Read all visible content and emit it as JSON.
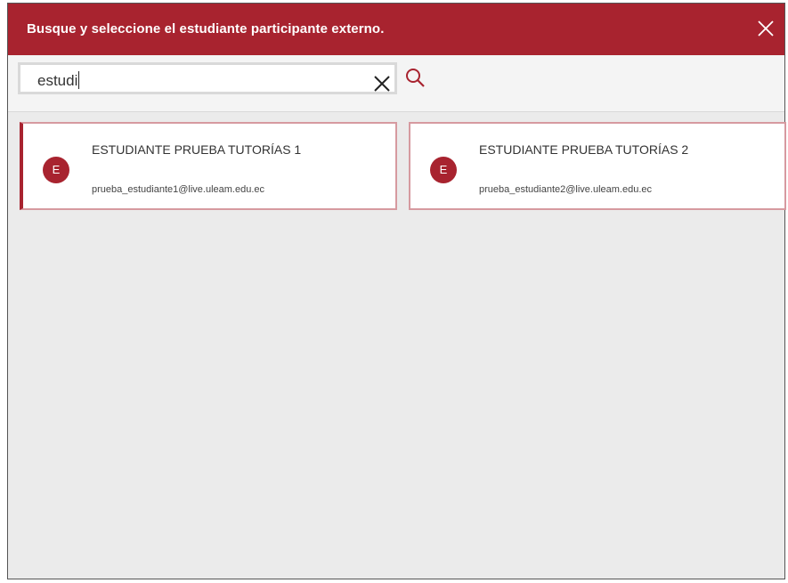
{
  "dialog": {
    "title": "Busque y seleccione el estudiante participante externo.",
    "close_icon": "close-icon"
  },
  "search": {
    "value": "estudi",
    "clear_icon": "clear-icon",
    "search_icon": "search-icon"
  },
  "results": [
    {
      "initial": "E",
      "name": "ESTUDIANTE PRUEBA TUTORÍAS 1",
      "email": "prueba_estudiante1@live.uleam.edu.ec"
    },
    {
      "initial": "E",
      "name": "ESTUDIANTE PRUEBA TUTORÍAS 2",
      "email": "prueba_estudiante2@live.uleam.edu.ec"
    }
  ],
  "colors": {
    "accent": "#a8232f",
    "card_border": "#d69aa0",
    "background": "#ebebeb"
  }
}
